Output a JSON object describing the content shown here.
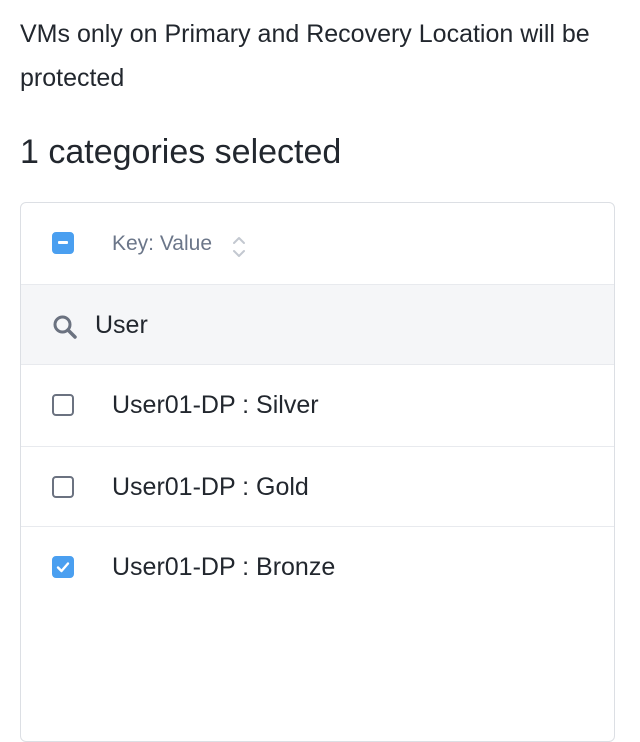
{
  "info_text": "VMs only on Primary and Recovery Location will be protected",
  "selection_count": "1 categories selected",
  "table": {
    "header_label": "Key: Value",
    "search_value": "User",
    "items": [
      {
        "label": "User01-DP : Silver",
        "checked": false
      },
      {
        "label": "User01-DP : Gold",
        "checked": false
      },
      {
        "label": "User01-DP : Bronze",
        "checked": true
      }
    ]
  },
  "colors": {
    "accent": "#4a9ff0",
    "text": "#22272e",
    "muted": "#6b7689"
  },
  "icons": [
    "checkbox-partial-icon",
    "sort-icon",
    "search-icon",
    "checkbox-icon",
    "checkmark-icon"
  ]
}
